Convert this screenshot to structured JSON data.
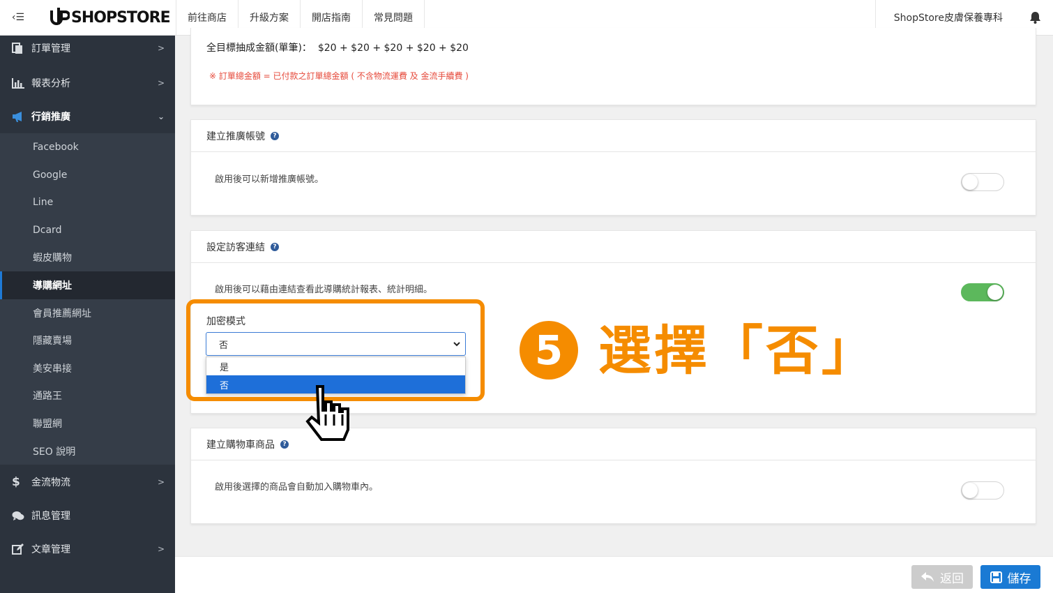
{
  "topbar": {
    "menu_toggle": "‹☰",
    "logo_text": "SHOPSTORE",
    "nav": [
      "前往商店",
      "升級方案",
      "開店指南",
      "常見問題"
    ],
    "store_name": "ShopStore皮膚保養專科"
  },
  "sidebar": {
    "items": [
      {
        "label": "訂單管理",
        "icon": "document-icon"
      },
      {
        "label": "報表分析",
        "icon": "bar-chart-icon"
      },
      {
        "label": "行銷推廣",
        "icon": "megaphone-icon"
      },
      {
        "label": "金流物流",
        "icon": "dollar-icon"
      },
      {
        "label": "訊息管理",
        "icon": "chat-icon"
      },
      {
        "label": "文章管理",
        "icon": "edit-icon"
      }
    ],
    "submenu": [
      "Facebook",
      "Google",
      "Line",
      "Dcard",
      "蝦皮購物",
      "導購網址",
      "會員推薦網址",
      "隱藏賣場",
      "美安串接",
      "通路王",
      "聯盟網",
      "SEO 說明"
    ],
    "current_submenu": "導購網址"
  },
  "top_card": {
    "formula": "全目標抽成金額(單筆)：  $20 + $20 + $20 + $20 + $20",
    "note": "※ 訂單總金額 = 已付款之訂單總金額 ( 不含物流運費 及 金流手續費 )",
    "note_color": "#e64a3b"
  },
  "card_affiliate": {
    "title": "建立推廣帳號",
    "desc": "啟用後可以新增推廣帳號。",
    "enabled": false
  },
  "card_visitor_link": {
    "title": "設定訪客連結",
    "desc": "啟用後可以藉由連結查看此導購統計報表、統計明細。",
    "enabled": true,
    "field_label": "加密模式",
    "select_value": "否",
    "options": [
      "是",
      "否"
    ],
    "highlighted_option": "否"
  },
  "card_cart": {
    "title": "建立購物車商品",
    "desc": "啟用後選擇的商品會自動加入購物車內。",
    "enabled": false
  },
  "annotation": {
    "step": "5",
    "text": "選擇「否」",
    "color": "#f58c00"
  },
  "footer": {
    "back_label": "返回",
    "save_label": "儲存"
  },
  "colors": {
    "sidebar_bg": "#2c333d",
    "primary": "#1a7ad4",
    "toggle_on": "#5cb85c"
  }
}
